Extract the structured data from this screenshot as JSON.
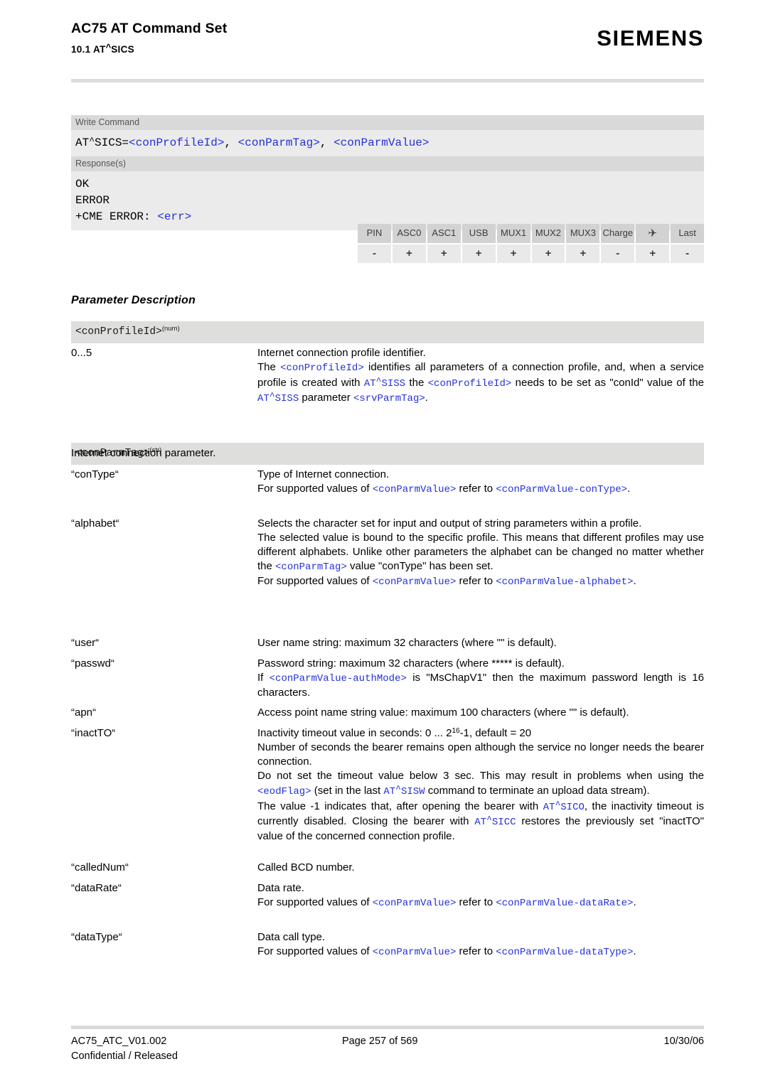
{
  "header": {
    "title": "AC75 AT Command Set",
    "subtitle_pre": "10.1 AT",
    "subtitle_caret": "^",
    "subtitle_post": "SICS",
    "brand": "SIEMENS"
  },
  "syntax_box": {
    "write_label": "Write Command",
    "command": {
      "prefix": "AT",
      "caret": "^",
      "name": "SICS=",
      "args": [
        "<conProfileId>",
        "<conParmTag>",
        "<conParmValue>"
      ],
      "separator": ", "
    },
    "response_label": "Response(s)",
    "responses": [
      "OK",
      "ERROR"
    ],
    "cme_prefix": "+CME ERROR: ",
    "cme_param": "<err>"
  },
  "support_table": {
    "headers": [
      "PIN",
      "ASC0",
      "ASC1",
      "USB",
      "MUX1",
      "MUX2",
      "MUX3",
      "Charge",
      "✈",
      "Last"
    ],
    "values": [
      "-",
      "+",
      "+",
      "+",
      "+",
      "+",
      "+",
      "-",
      "+",
      "-"
    ]
  },
  "section": {
    "heading": "Parameter Description"
  },
  "param_conprofileid": {
    "name": "<conProfileId>",
    "type": "(num)",
    "term": "0...5",
    "lines": [
      "Internet connection profile identifier.",
      "The <conProfileId> identifies all parameters of a connection profile, and, when a service profile is created with AT^SISS the <conProfileId> needs to be set as \"conId\" value of the AT^SISS parameter <srvParmTag>."
    ]
  },
  "param_conparmtag": {
    "name": "<conParmTag>",
    "type": "(str)",
    "intro": "Internet connection parameter.",
    "entries": [
      {
        "term": "“conType“",
        "lines": [
          "Type of Internet connection.",
          "For supported values of <conParmValue> refer to <conParmValue-conType>."
        ]
      },
      {
        "term": "“alphabet“",
        "lines": [
          "Selects the character set for input and output of string parameters within a profile.",
          "The selected value is bound to the specific profile. This means that different profiles may use different alphabets. Unlike other parameters the alphabet can be changed no matter whether the <conParmTag> value \"conType\" has been set.",
          "For supported values of <conParmValue> refer to <conParmValue-alphabet>."
        ]
      },
      {
        "term": "“user“",
        "lines": [
          "User name string: maximum 32 characters (where \"\" is default)."
        ]
      },
      {
        "term": "“passwd“",
        "lines": [
          "Password string: maximum 32 characters (where ***** is default).",
          "If <conParmValue-authMode> is \"MsChapV1\" then the maximum password length is 16 characters."
        ]
      },
      {
        "term": "“apn“",
        "lines": [
          "Access point name string value: maximum 100 characters (where \"\" is default)."
        ]
      },
      {
        "term": "“inactTO“",
        "lines": [
          "Inactivity timeout value in seconds: 0 ... 2^16-1, default = 20",
          "Number of seconds the bearer remains open although the service no longer needs the bearer connection.",
          "Do not set the timeout value below 3 sec. This may result in problems when using the <eodFlag> (set in the last AT^SISW command to terminate an upload data stream).",
          "The value -1 indicates that, after opening the bearer with AT^SICO, the inactivity timeout is currently disabled. Closing the bearer with AT^SICC restores the previously set \"inactTO\" value of the concerned connection profile."
        ]
      },
      {
        "term": "“calledNum“",
        "lines": [
          "Called BCD number."
        ]
      },
      {
        "term": "“dataRate“",
        "lines": [
          "Data rate.",
          "For supported values of <conParmValue> refer to <conParmValue-dataRate>."
        ]
      },
      {
        "term": "“dataType“",
        "lines": [
          "Data call type.",
          "For supported values of <conParmValue> refer to <conParmValue-dataType>."
        ]
      }
    ]
  },
  "footer": {
    "doc_id": "AC75_ATC_V01.002",
    "page": "Page 257 of 569",
    "date": "10/30/06",
    "classification": "Confidential / Released"
  }
}
